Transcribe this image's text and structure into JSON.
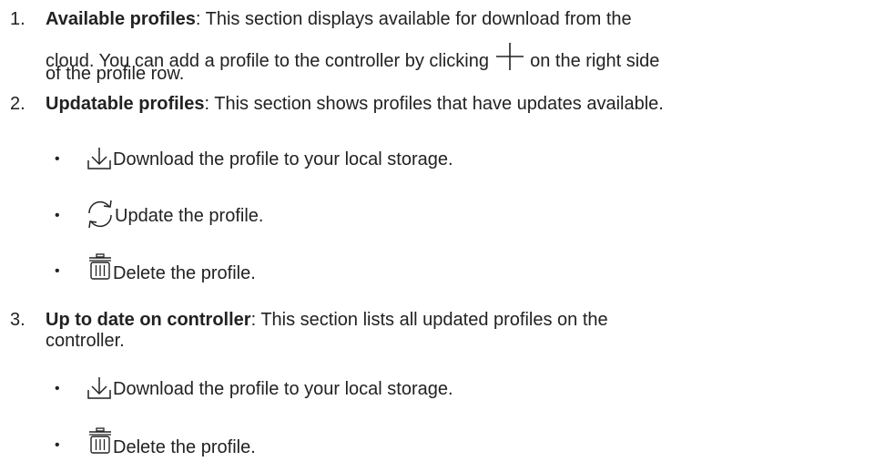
{
  "items": [
    {
      "number": "1.",
      "title": "Available profiles",
      "sep": ":",
      "line1": " This section displays available for download from the",
      "line2a": "cloud. You can add a profile to the controller by clicking ",
      "inline_icon": "plus-icon",
      "line2b": " on the right side",
      "line3": "of the profile row."
    },
    {
      "number": "2.",
      "title": "Updatable profiles",
      "sep": ":",
      "line1": " This section shows profiles that have updates available.",
      "bullets": [
        {
          "icon": "download-icon",
          "dot": "•",
          "text": "Download the profile to your local storage."
        },
        {
          "icon": "refresh-icon",
          "dot": "•",
          "text": "Update the profile."
        },
        {
          "icon": "trash-icon",
          "dot": "•",
          "text": "Delete the profile."
        }
      ]
    },
    {
      "number": "3.",
      "title": "Up to date on controller",
      "sep": ":",
      "line1": " This section lists all updated profiles on the",
      "line2": "controller.",
      "bullets": [
        {
          "icon": "download-icon",
          "dot": "•",
          "text": "Download the profile to your local storage."
        },
        {
          "icon": "trash-icon",
          "dot": "•",
          "text": "Delete the profile."
        }
      ]
    }
  ]
}
